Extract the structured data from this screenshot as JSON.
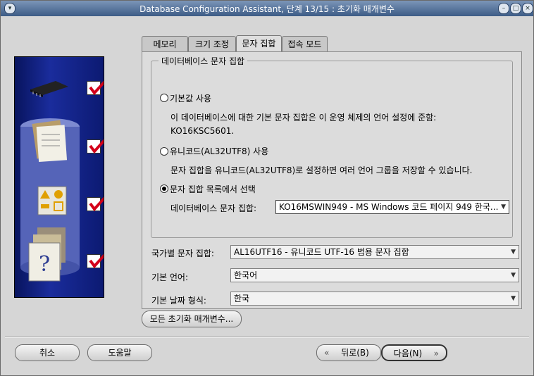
{
  "window": {
    "title": "Database Configuration Assistant, 단계 13/15 : 초기화 매개변수"
  },
  "tabs": [
    {
      "label": "메모리"
    },
    {
      "label": "크기 조정"
    },
    {
      "label": "문자 집합"
    },
    {
      "label": "접속 모드"
    }
  ],
  "charset_group": {
    "title": "데이터베이스 문자 집합",
    "option_default": "기본값 사용",
    "option_default_desc1": "이 데이터베이스에 대한 기본 문자 집합은 이 운영 체제의 언어 설정에 준함:",
    "option_default_desc2": "KO16KSC5601.",
    "option_unicode": "유니코드(AL32UTF8) 사용",
    "option_unicode_desc": "문자 집합을 유니코드(AL32UTF8)로 설정하면 여러 언어 그룹을 저장할 수 있습니다.",
    "option_list": "문자 집합 목록에서 선택",
    "db_charset_label": "데이터베이스 문자 집합:",
    "db_charset_value": "KO16MSWIN949 - MS Windows 코드 페이지 949 한국..."
  },
  "fields": {
    "national_label": "국가별 문자 집합:",
    "national_value": "AL16UTF16 - 유니코드 UTF-16 범용 문자 집합",
    "language_label": "기본 언어:",
    "language_value": "한국어",
    "date_label": "기본 날짜 형식:",
    "date_value": "한국"
  },
  "buttons": {
    "all_params": "모든 초기화 매개변수...",
    "cancel": "취소",
    "help": "도움말",
    "back": "뒤로(B)",
    "next": "다음(N)"
  },
  "colors": {
    "titlebar": "#3d5c86",
    "illustration": "#1a2c9c",
    "check": "#d4001a"
  }
}
